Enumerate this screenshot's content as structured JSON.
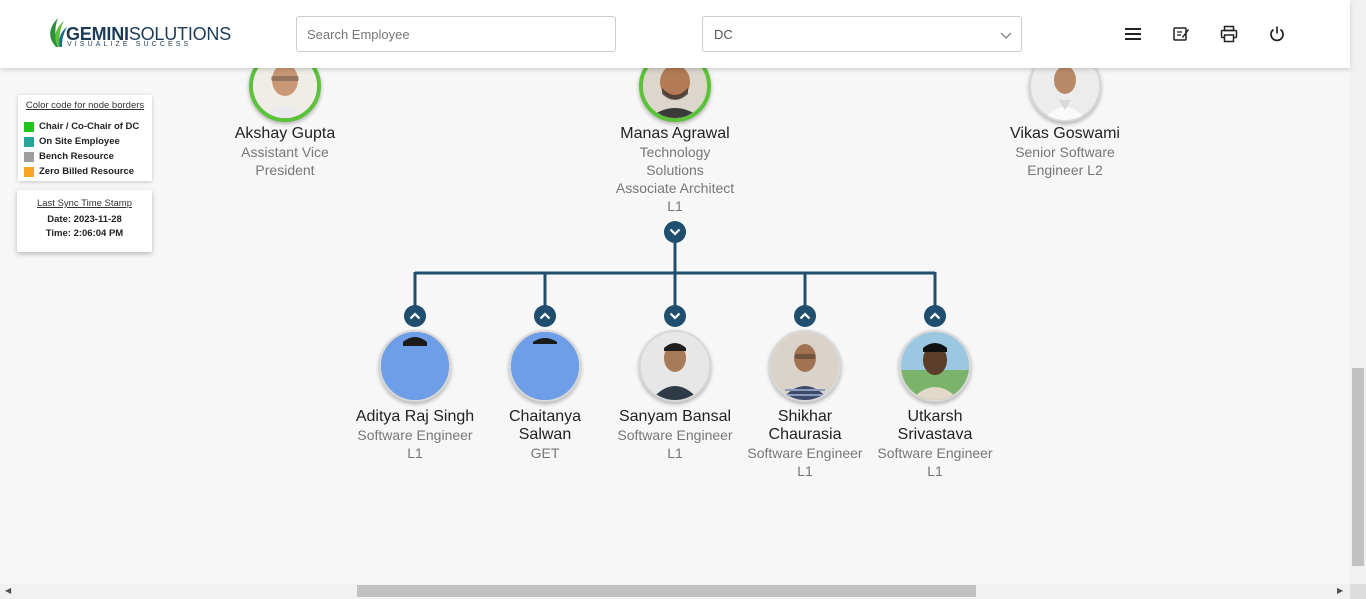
{
  "header": {
    "logo_name": "GEMINI",
    "logo_name_rest": "SOLUTIONS",
    "logo_tagline": "VISUALIZE SUCCESS",
    "search_placeholder": "Search Employee",
    "department_select": "DC",
    "icons": [
      "menu-icon",
      "edit-notes-icon",
      "print-icon",
      "power-icon"
    ]
  },
  "legend": {
    "title": "Color code for node borders",
    "items": [
      {
        "label": "Chair / Co-Chair of DC",
        "color": "#21c31f"
      },
      {
        "label": "On Site Employee",
        "color": "#26a69a"
      },
      {
        "label": "Bench Resource",
        "color": "#9e9e9e"
      },
      {
        "label": "Zero Billed Resource",
        "color": "#f5a623"
      }
    ]
  },
  "sync": {
    "title": "Last Sync Time Stamp",
    "date": "Date: 2023-11-28",
    "time": "Time: 2:06:04 PM"
  },
  "top_nodes": [
    {
      "name": "Akshay Gupta",
      "title_lines": [
        "Assistant Vice",
        "President"
      ],
      "border": "green"
    },
    {
      "name": "Manas Agrawal",
      "title_lines": [
        "Technology",
        "Solutions",
        "Associate Architect",
        "L1"
      ],
      "border": "green"
    },
    {
      "name": "Vikas Goswami",
      "title_lines": [
        "Senior Software",
        "Engineer L2"
      ],
      "border": "none"
    }
  ],
  "child_nodes": [
    {
      "name_lines": [
        "Aditya Raj Singh"
      ],
      "title_lines": [
        "Software Engineer",
        "L1"
      ],
      "toggle": "up"
    },
    {
      "name_lines": [
        "Chaitanya",
        "Salwan"
      ],
      "title_lines": [
        "GET"
      ],
      "toggle": "up"
    },
    {
      "name_lines": [
        "Sanyam Bansal"
      ],
      "title_lines": [
        "Software Engineer",
        "L1"
      ],
      "toggle": "down"
    },
    {
      "name_lines": [
        "Shikhar",
        "Chaurasia"
      ],
      "title_lines": [
        "Software Engineer",
        "L1"
      ],
      "toggle": "up"
    },
    {
      "name_lines": [
        "Utkarsh",
        "Srivastava"
      ],
      "title_lines": [
        "Software Engineer",
        "L1"
      ],
      "toggle": "up"
    }
  ],
  "colors": {
    "connector": "#1f4e6e",
    "chair_border": "#5cc23a",
    "placeholder_avatar": "#6f9ee8"
  }
}
